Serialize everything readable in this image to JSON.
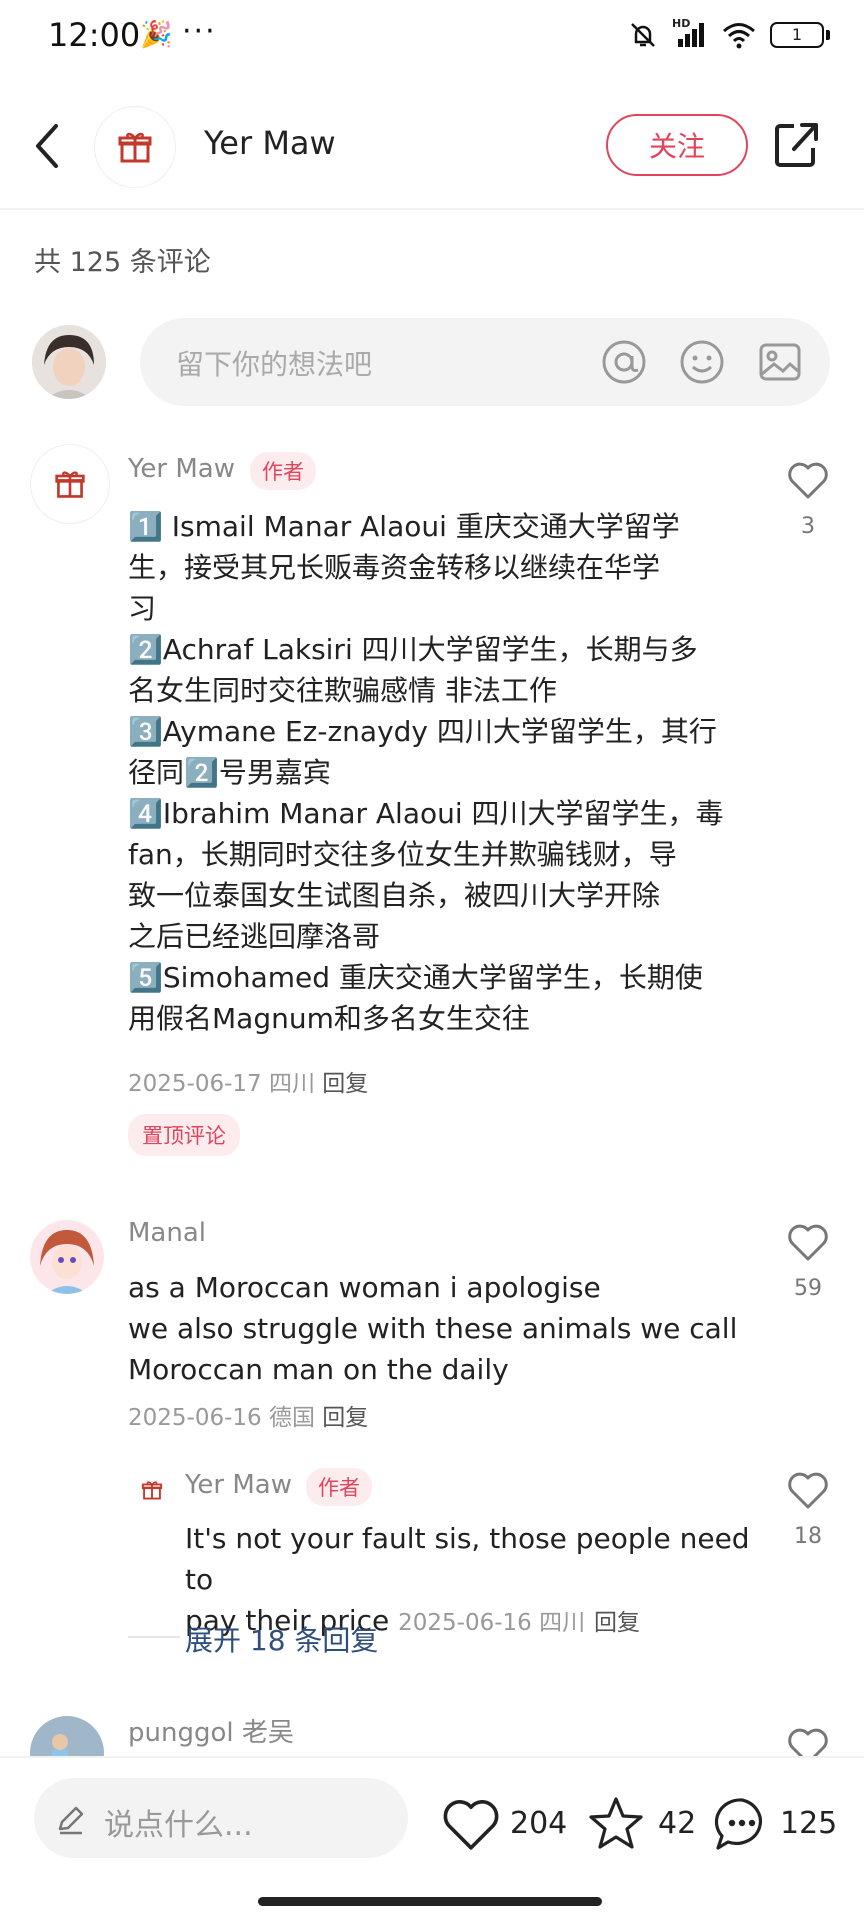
{
  "status_bar": {
    "time": "12:00",
    "emoji": "🎉",
    "dots": "···",
    "network": "HD",
    "battery": "1"
  },
  "header": {
    "username": "Yer Maw",
    "follow_label": "关注",
    "avatar_icon": "gift-icon",
    "back_icon": "chevron-left-icon",
    "share_icon": "share-icon"
  },
  "comment_count_line": "共 125 条评论",
  "comment_input": {
    "placeholder": "留下你的想法吧"
  },
  "comments": [
    {
      "username": "Yer Maw",
      "badge": "作者",
      "lines": [
        "1️⃣ Ismail Manar Alaoui 重庆交通大学留学",
        "生，接受其兄长贩毒资金转移以继续在华学",
        "习",
        "2️⃣Achraf Laksiri 四川大学留学生，长期与多",
        "名女生同时交往欺骗感情 非法工作",
        "3️⃣Aymane Ez-znaydy 四川大学留学生，其行",
        "径同2️⃣号男嘉宾",
        "4️⃣Ibrahim Manar Alaoui 四川大学留学生，毒",
        "fan，长期同时交往多位女生并欺骗钱财，导",
        "致一位泰国女生试图自杀，被四川大学开除",
        "之后已经逃回摩洛哥",
        "5️⃣Simohamed 重庆交通大学留学生，长期使",
        "用假名Magnum和多名女生交往"
      ],
      "meta": "2025-06-17 四川",
      "reply_label": "回复",
      "likes": "3",
      "pinned_label": "置顶评论"
    },
    {
      "username": "Manal",
      "lines": [
        "as a Moroccan woman i apologise",
        "we also struggle with these animals we call",
        "Moroccan man on the daily"
      ],
      "meta": "2025-06-16 德国",
      "reply_label": "回复",
      "likes": "59"
    },
    {
      "username": "Yer Maw",
      "badge": "作者",
      "lines": [
        "It's not your fault sis, those people need to",
        "pay their price"
      ],
      "meta": "2025-06-16 四川",
      "reply_label": "回复",
      "likes": "18",
      "expand_label": "展开 18 条回复"
    },
    {
      "username": "punggol 老吴"
    }
  ],
  "bottom_bar": {
    "placeholder": "说点什么...",
    "likes": "204",
    "stars": "42",
    "comments": "125"
  }
}
